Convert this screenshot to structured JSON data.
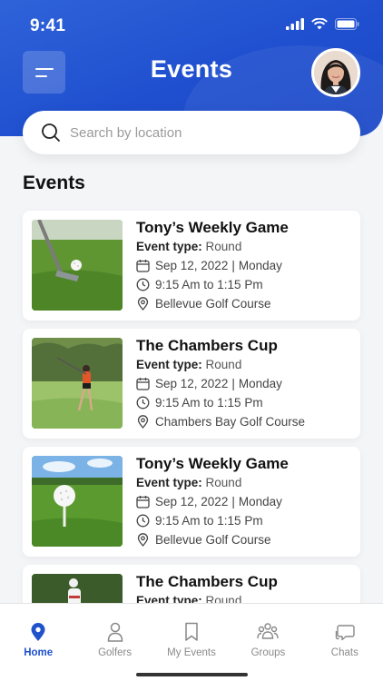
{
  "status": {
    "time": "9:41"
  },
  "header": {
    "title": "Events"
  },
  "search": {
    "placeholder": "Search by location"
  },
  "section": {
    "title": "Events"
  },
  "events": [
    {
      "title": "Tony’s Weekly Game",
      "type_label": "Event type:",
      "type_value": "Round",
      "date": "Sep 12, 2022",
      "day": "Monday",
      "time": "9:15 Am to 1:15 Pm",
      "location": "Bellevue Golf Course",
      "image": "golf-club-ball"
    },
    {
      "title": "The Chambers Cup",
      "type_label": "Event type:",
      "type_value": "Round",
      "date": "Sep 12, 2022",
      "day": "Monday",
      "time": "9:15 Am to 1:15 Pm",
      "location": "Chambers Bay Golf Course",
      "image": "golfer-swing"
    },
    {
      "title": "Tony’s Weekly Game",
      "type_label": "Event type:",
      "type_value": "Round",
      "date": "Sep 12, 2022",
      "day": "Monday",
      "time": "9:15 Am to 1:15 Pm",
      "location": "Bellevue Golf Course",
      "image": "golf-ball-tee"
    },
    {
      "title": "The Chambers Cup",
      "type_label": "Event type:",
      "type_value": "Round",
      "date": "",
      "day": "",
      "time": "",
      "location": "",
      "image": "golfer-course"
    }
  ],
  "tabs": [
    {
      "label": "Home",
      "icon": "location-pin-icon",
      "active": true
    },
    {
      "label": "Golfers",
      "icon": "user-icon",
      "active": false
    },
    {
      "label": "My Events",
      "icon": "bookmark-icon",
      "active": false
    },
    {
      "label": "Groups",
      "icon": "group-icon",
      "active": false
    },
    {
      "label": "Chats",
      "icon": "chat-icon",
      "active": false
    }
  ],
  "colors": {
    "primary": "#2052cc",
    "header_gradient_start": "#2f63d9",
    "background": "#f4f5f7"
  }
}
